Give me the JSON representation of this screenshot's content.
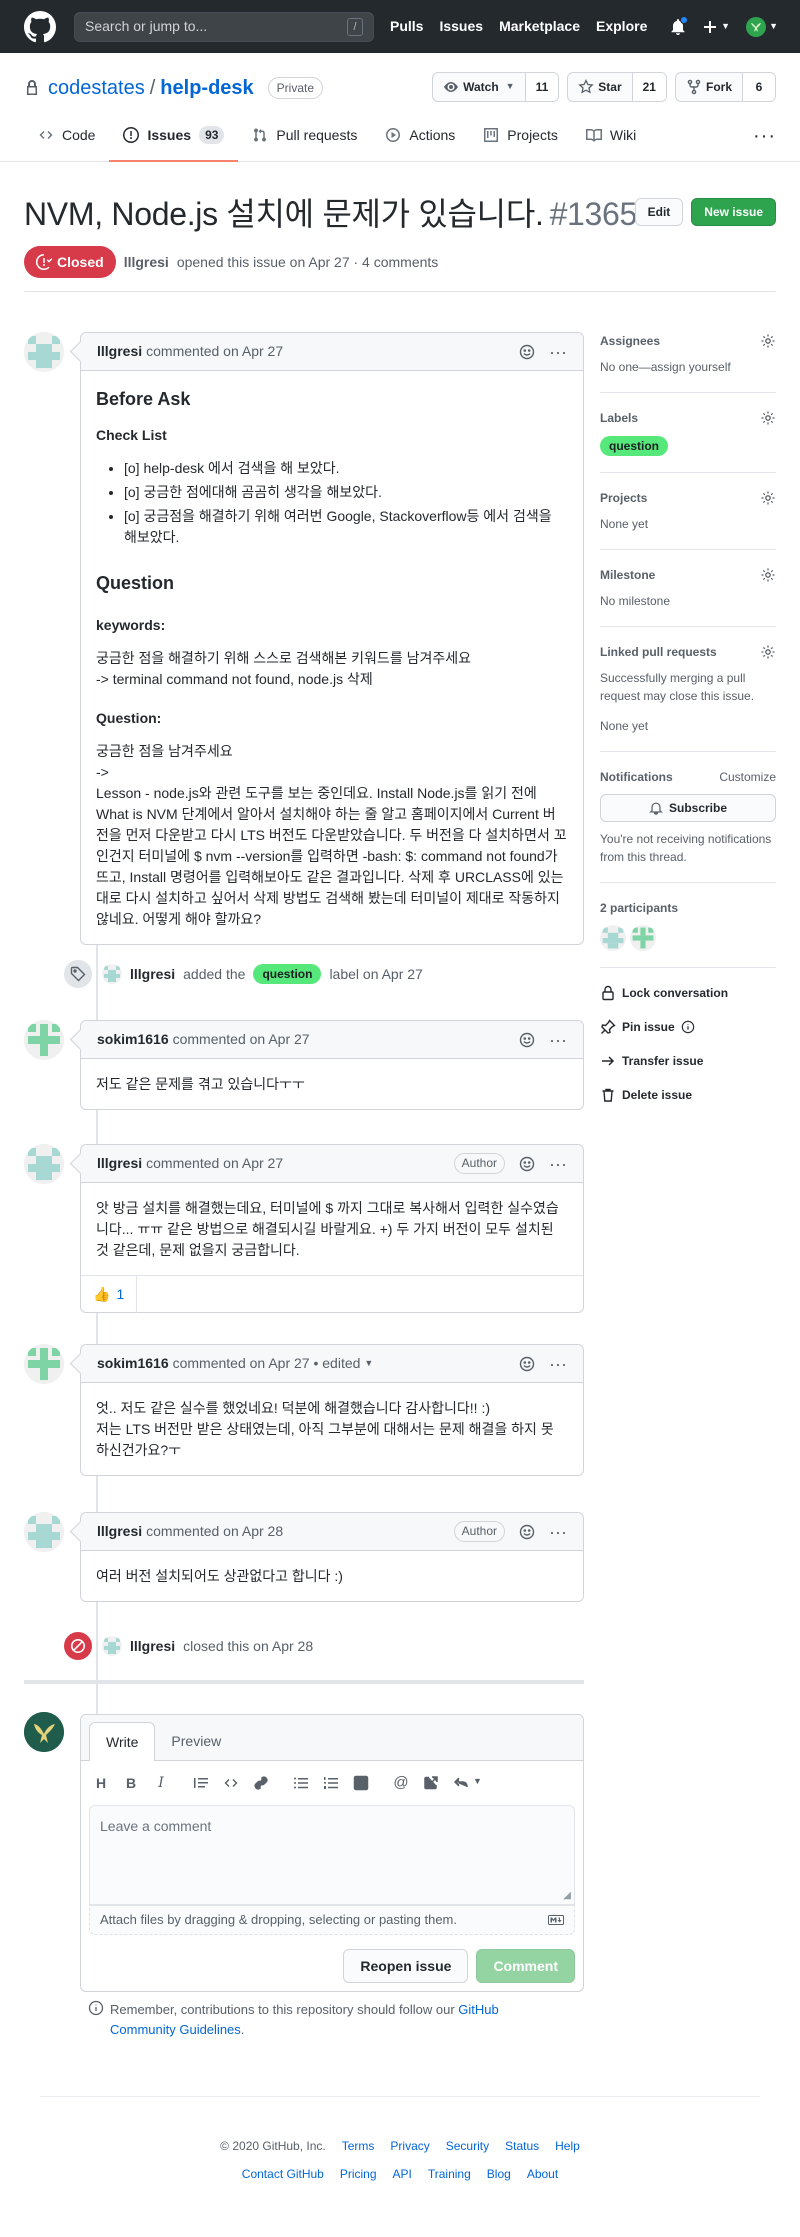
{
  "header": {
    "search_placeholder": "Search or jump to...",
    "search_shortcut": "/",
    "nav": [
      "Pulls",
      "Issues",
      "Marketplace",
      "Explore"
    ]
  },
  "repo": {
    "owner": "codestates",
    "name": "help-desk",
    "visibility": "Private",
    "watch_label": "Watch",
    "watch_count": "11",
    "star_label": "Star",
    "star_count": "21",
    "fork_label": "Fork",
    "fork_count": "6",
    "tabs": [
      {
        "label": "Code"
      },
      {
        "label": "Issues",
        "count": "93"
      },
      {
        "label": "Pull requests"
      },
      {
        "label": "Actions"
      },
      {
        "label": "Projects"
      },
      {
        "label": "Wiki"
      }
    ]
  },
  "issue": {
    "title": "NVM, Node.js 설치에 문제가 있습니다.",
    "number": "#1365",
    "edit_label": "Edit",
    "new_issue_label": "New issue",
    "state": "Closed",
    "author": "lllgresi",
    "meta_text": "opened this issue on Apr 27 · 4 comments"
  },
  "comments": [
    {
      "author": "lllgresi",
      "meta": "commented on Apr 27",
      "h_before": "Before Ask",
      "h_checklist": "Check List",
      "checklist": [
        "[o] help-desk 에서 검색을 해 보았다.",
        "[o] 궁금한 점에대해 곰곰히 생각을 해보았다.",
        "[o] 궁금점을 해결하기 위해 여러번 Google, Stackoverflow등 에서 검색을 해보았다."
      ],
      "h_question": "Question",
      "h_keywords": "keywords:",
      "keywords_line1": "궁금한 점을 해결하기 위해 스스로 검색해본 키워드를 남겨주세요",
      "keywords_line2": "-> terminal command not found, node.js 삭제",
      "h_question2": "Question:",
      "question_line1": "궁금한 점을 남겨주세요",
      "question_line2": "->",
      "question_body": "Lesson - node.js와 관련 도구를 보는 중인데요. Install Node.js를 읽기 전에 What is NVM 단계에서 알아서 설치해야 하는 줄 알고 홈페이지에서 Current 버전을 먼저 다운받고 다시 LTS 버전도 다운받았습니다. 두 버전을 다 설치하면서 꼬인건지 터미널에 $ nvm --version를 입력하면 -bash: $: command not found가 뜨고, Install 명령어를 입력해보아도 같은 결과입니다. 삭제 후 URCLASS에 있는대로 다시 설치하고 싶어서 삭제 방법도 검색해 봤는데 터미널이 제대로 작동하지 않네요. 어떻게 해야 할까요?"
    },
    {
      "author": "sokim1616",
      "meta": "commented on Apr 27",
      "body": "저도 같은 문제를 겪고 있습니다ㅜㅜ"
    },
    {
      "author": "lllgresi",
      "meta": "commented on Apr 27",
      "badge": "Author",
      "body": "앗 방금 설치를 해결했는데요, 터미널에 $ 까지 그대로 복사해서 입력한 실수였습니다... ㅠㅠ 같은 방법으로 해결되시길 바랄게요. +) 두 가지 버전이 모두 설치된 것 같은데, 문제 없을지 궁금합니다.",
      "reaction_emoji": "👍",
      "reaction_count": "1"
    },
    {
      "author": "sokim1616",
      "meta": "commented on Apr 27 • edited",
      "body_line1": "엇.. 저도 같은 실수를 했었네요! 덕분에 해결했습니다 감사합니다!! :)",
      "body_line2": "저는 LTS 버전만 받은 상태였는데, 아직 그부분에 대해서는 문제 해결을 하지 못 하신건가요?ㅜ"
    },
    {
      "author": "lllgresi",
      "meta": "commented on Apr 28",
      "badge": "Author",
      "body": "여러 버전 설치되어도 상관없다고 합니다 :)"
    }
  ],
  "events": {
    "label_actor": "lllgresi",
    "label_text_before": "added the",
    "label_name": "question",
    "label_text_after": "label on Apr 27",
    "close_actor": "lllgresi",
    "close_text": "closed this on Apr 28"
  },
  "composer": {
    "tab_write": "Write",
    "tab_preview": "Preview",
    "placeholder": "Leave a comment",
    "attach_hint": "Attach files by dragging & dropping, selecting or pasting them.",
    "reopen_label": "Reopen issue",
    "comment_label": "Comment",
    "remember_text": "Remember, contributions to this repository should follow our",
    "remember_link": "GitHub Community Guidelines",
    "remember_end": "."
  },
  "sidebar": {
    "assignees_title": "Assignees",
    "assignees_text": "No one—assign yourself",
    "labels_title": "Labels",
    "label": "question",
    "projects_title": "Projects",
    "projects_text": "None yet",
    "milestone_title": "Milestone",
    "milestone_text": "No milestone",
    "linked_title": "Linked pull requests",
    "linked_text": "Successfully merging a pull request may close this issue.",
    "linked_none": "None yet",
    "notifications_title": "Notifications",
    "customize": "Customize",
    "subscribe": "Subscribe",
    "notif_text": "You're not receiving notifications from this thread.",
    "participants_title": "2 participants",
    "lock": "Lock conversation",
    "pin": "Pin issue",
    "transfer": "Transfer issue",
    "delete": "Delete issue"
  },
  "footer": {
    "copyright": "© 2020 GitHub, Inc.",
    "row1": [
      "Terms",
      "Privacy",
      "Security",
      "Status",
      "Help"
    ],
    "row2": [
      "Contact GitHub",
      "Pricing",
      "API",
      "Training",
      "Blog",
      "About"
    ]
  }
}
